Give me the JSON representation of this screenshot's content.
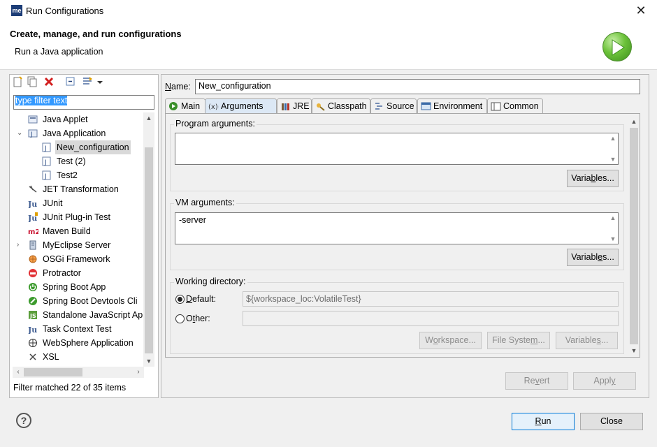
{
  "window": {
    "app_logo": "me",
    "title": "Run Configurations",
    "close_glyph": "✕"
  },
  "banner": {
    "title": "Create, manage, and run configurations",
    "subtitle": "Run a Java application",
    "graphic_icon": "run-play-icon"
  },
  "left": {
    "toolbar_icons": [
      "new-launch-config-icon",
      "duplicate-icon",
      "delete-icon",
      "collapse-all-icon",
      "filter-icon",
      "dropdown-arrow-icon"
    ],
    "filter_text": "type filter text",
    "tree": [
      {
        "label": "Java Applet",
        "icon": "java-applet-icon",
        "level": 0
      },
      {
        "label": "Java Application",
        "icon": "java-application-icon",
        "level": 0,
        "expanded": true
      },
      {
        "label": "New_configuration",
        "icon": "java-config-icon",
        "level": 1,
        "selected": true
      },
      {
        "label": "Test (2)",
        "icon": "java-config-icon",
        "level": 1
      },
      {
        "label": "Test2",
        "icon": "java-config-icon",
        "level": 1
      },
      {
        "label": "JET Transformation",
        "icon": "jet-icon",
        "level": 0
      },
      {
        "label": "JUnit",
        "icon": "junit-icon",
        "level": 0
      },
      {
        "label": "JUnit Plug-in Test",
        "icon": "junit-plugin-icon",
        "level": 0
      },
      {
        "label": "Maven Build",
        "icon": "maven-icon",
        "level": 0
      },
      {
        "label": "MyEclipse Server",
        "icon": "server-icon",
        "level": 0,
        "collapsed": true
      },
      {
        "label": "OSGi Framework",
        "icon": "osgi-icon",
        "level": 0
      },
      {
        "label": "Protractor",
        "icon": "protractor-icon",
        "level": 0
      },
      {
        "label": "Spring Boot App",
        "icon": "spring-boot-icon",
        "level": 0
      },
      {
        "label": "Spring Boot Devtools Cli",
        "icon": "spring-devtools-icon",
        "level": 0
      },
      {
        "label": "Standalone JavaScript Ap",
        "icon": "javascript-icon",
        "level": 0
      },
      {
        "label": "Task Context Test",
        "icon": "task-context-icon",
        "level": 0
      },
      {
        "label": "WebSphere Application",
        "icon": "websphere-icon",
        "level": 0
      },
      {
        "label": "XSL",
        "icon": "xsl-icon",
        "level": 0
      }
    ],
    "status": "Filter matched 22 of 35 items"
  },
  "right": {
    "name_label": "Name:",
    "name_value": "New_configuration",
    "tabs": [
      {
        "label": "Main",
        "icon": "main-tab-icon"
      },
      {
        "label": "Arguments",
        "icon": "arguments-tab-icon",
        "active": true
      },
      {
        "label": "JRE",
        "icon": "jre-tab-icon"
      },
      {
        "label": "Classpath",
        "icon": "classpath-tab-icon"
      },
      {
        "label": "Source",
        "icon": "source-tab-icon"
      },
      {
        "label": "Environment",
        "icon": "environment-tab-icon"
      },
      {
        "label": "Common",
        "icon": "common-tab-icon"
      }
    ],
    "program_args_label": "Program arguments:",
    "program_args_value": "",
    "vm_args_label": "VM arguments:",
    "vm_args_value": "-server",
    "variables_label": "Variables...",
    "working_dir_label": "Working directory:",
    "default_label": "Default:",
    "default_value": "${workspace_loc:VolatileTest}",
    "other_label": "Other:",
    "other_value": "",
    "workspace_btn": "Workspace...",
    "filesystem_btn": "File System...",
    "variables_btn_wd": "Variables...",
    "revert_btn": "Revert",
    "apply_btn": "Apply"
  },
  "footer": {
    "help_glyph": "?",
    "run_btn": "Run",
    "close_btn": "Close"
  }
}
